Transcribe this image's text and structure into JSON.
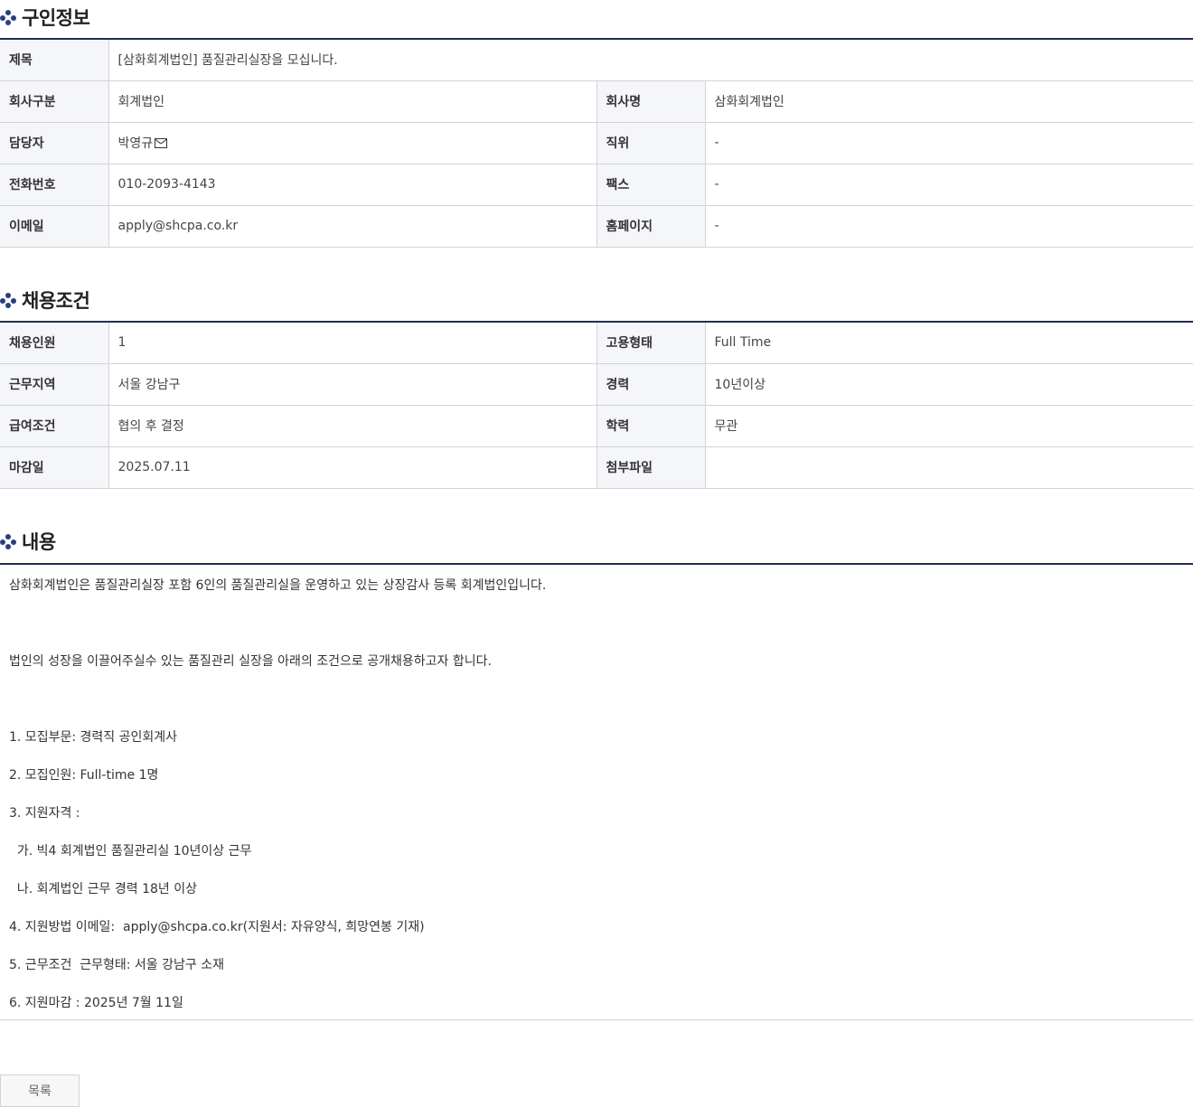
{
  "sections": {
    "recruit_info": "구인정보",
    "conditions": "채용조건",
    "content": "내용"
  },
  "recruit_info": {
    "title_label": "제목",
    "title_value": "[삼화회계법인] 품질관리실장을 모십니다.",
    "company_type_label": "회사구분",
    "company_type_value": "회계법인",
    "company_name_label": "회사명",
    "company_name_value": "삼화회계법인",
    "manager_label": "담당자",
    "manager_value": "박영규",
    "position_label": "직위",
    "position_value": "-",
    "phone_label": "전화번호",
    "phone_value": "010-2093-4143",
    "fax_label": "팩스",
    "fax_value": "-",
    "email_label": "이메일",
    "email_value": "apply@shcpa.co.kr",
    "homepage_label": "홈페이지",
    "homepage_value": "-"
  },
  "conditions": {
    "headcount_label": "채용인원",
    "headcount_value": "1",
    "employment_type_label": "고용형태",
    "employment_type_value": "Full Time",
    "location_label": "근무지역",
    "location_value": "서울 강남구",
    "career_label": "경력",
    "career_value": "10년이상",
    "salary_label": "급여조건",
    "salary_value": "협의 후 결정",
    "education_label": "학력",
    "education_value": "무관",
    "deadline_label": "마감일",
    "deadline_value": "2025.07.11",
    "attachment_label": "첨부파일",
    "attachment_value": ""
  },
  "content": {
    "lines": [
      "삼화회계법인은 품질관리실장 포함 6인의 품질관리실을 운영하고 있는 상장감사 등록 회계법인입니다.",
      "법인의 성장을 이끌어주실수 있는 품질관리 실장을 아래의 조건으로 공개채용하고자 합니다.",
      "1. 모집부문: 경력직 공인회계사",
      "2. 모집인원: Full-time 1명",
      "3. 지원자격 :",
      "  가. 빅4 회계법인 품질관리실 10년이상 근무",
      "  나. 회계법인 근무 경력 18년 이상",
      "4. 지원방법 이메일:  apply@shcpa.co.kr(지원서: 자유양식, 희망연봉 기재)",
      "5. 근무조건  근무형태: 서울 강남구 소재",
      "6. 지원마감 : 2025년 7월 11일"
    ]
  },
  "buttons": {
    "list_label": "목록"
  }
}
